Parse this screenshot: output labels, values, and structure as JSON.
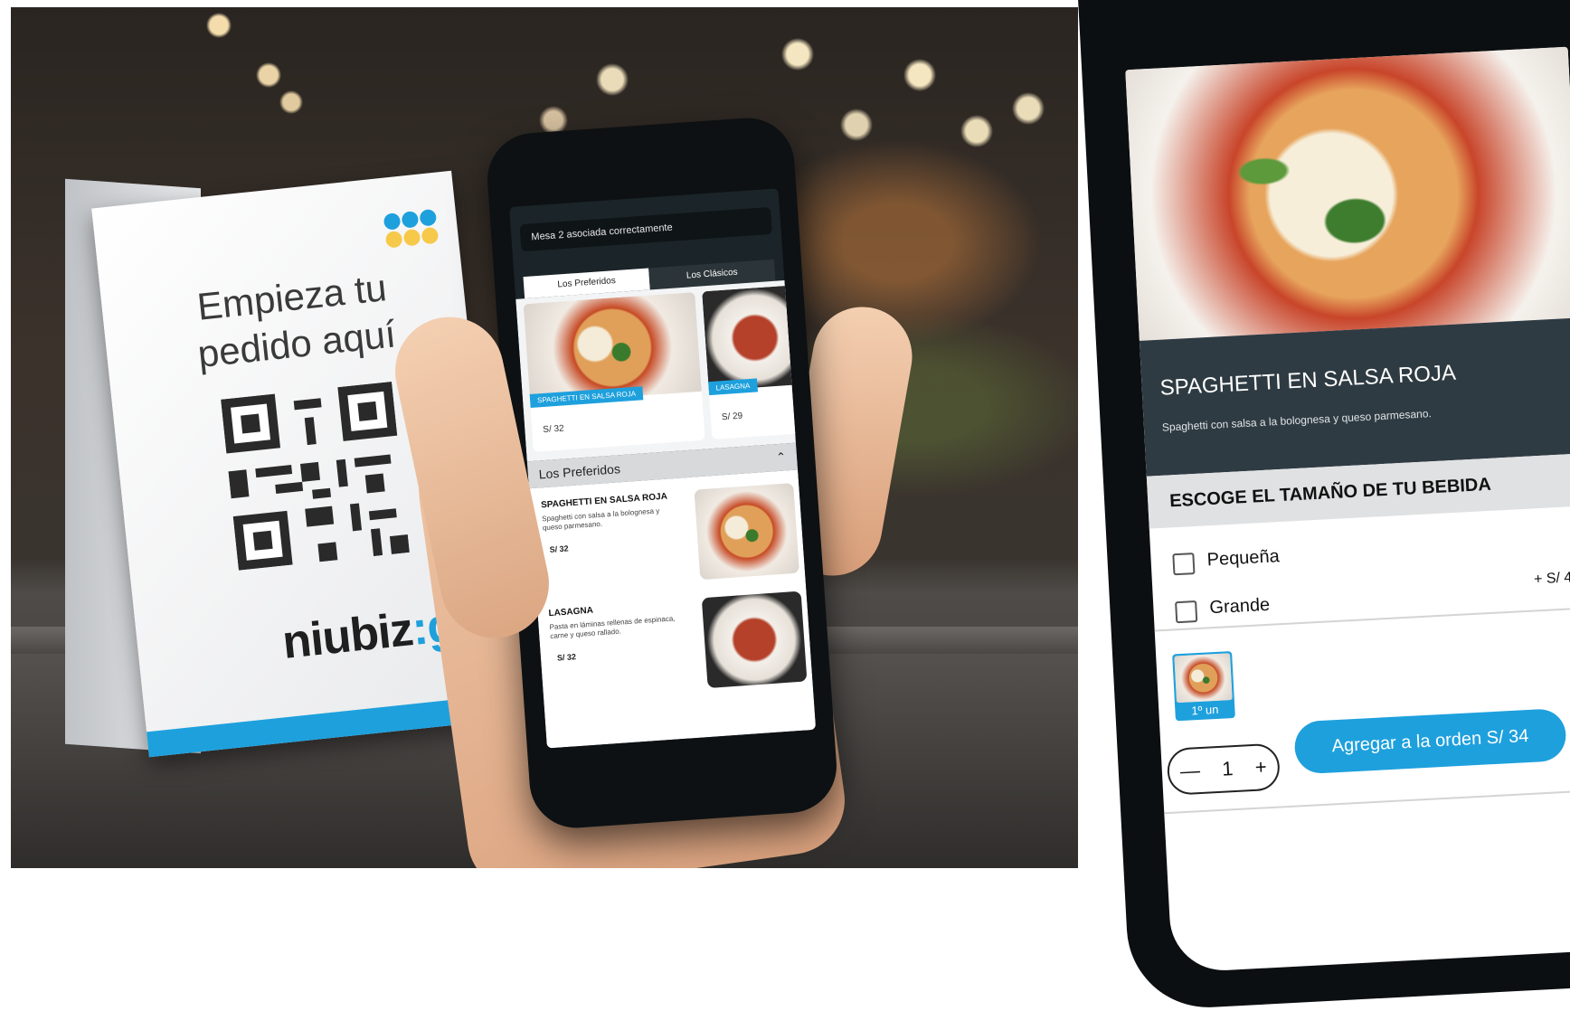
{
  "tent": {
    "title": "Empieza tu pedido aquí",
    "brand_main": "niubiz",
    "brand_sep": ":",
    "brand_go": "go"
  },
  "phone_small": {
    "toast": "Mesa 2 asociada correctamente",
    "tabs": [
      "Los Preferidos",
      "Los Clásicos"
    ],
    "cards": [
      {
        "tag": "SPAGHETTI EN SALSA ROJA",
        "price": "S/ 32"
      },
      {
        "tag": "LASAGNA",
        "price": "S/ 29"
      }
    ],
    "section_title": "Los Preferidos",
    "items": [
      {
        "name": "SPAGHETTI  EN SALSA ROJA",
        "desc": "Spaghetti con salsa a la bolognesa y queso parmesano.",
        "price": "S/ 32"
      },
      {
        "name": "LASAGNA",
        "desc": "Pasta en láminas rellenas de espinaca, carne y queso rallado.",
        "price": "S/ 32"
      }
    ]
  },
  "phone_large": {
    "dish_title": "SPAGHETTI EN SALSA ROJA",
    "dish_desc": "Spaghetti con salsa a la bolognesa y queso parmesano.",
    "size_heading": "ESCOGE EL TAMAÑO DE TU BEBIDA",
    "options": [
      {
        "label": "Pequeña",
        "extra": ""
      },
      {
        "label": "Grande",
        "extra": "+ S/ 4"
      }
    ],
    "mini_caption": "1º un",
    "stepper": {
      "minus": "—",
      "value": "1",
      "plus": "+"
    },
    "add_button": "Agregar a la orden S/ 34"
  },
  "colors": {
    "brand_blue": "#1ea0dd",
    "dark_header": "#2f3b43",
    "dot_yellow": "#f6c94a",
    "dot_blue": "#1ea0dd"
  }
}
